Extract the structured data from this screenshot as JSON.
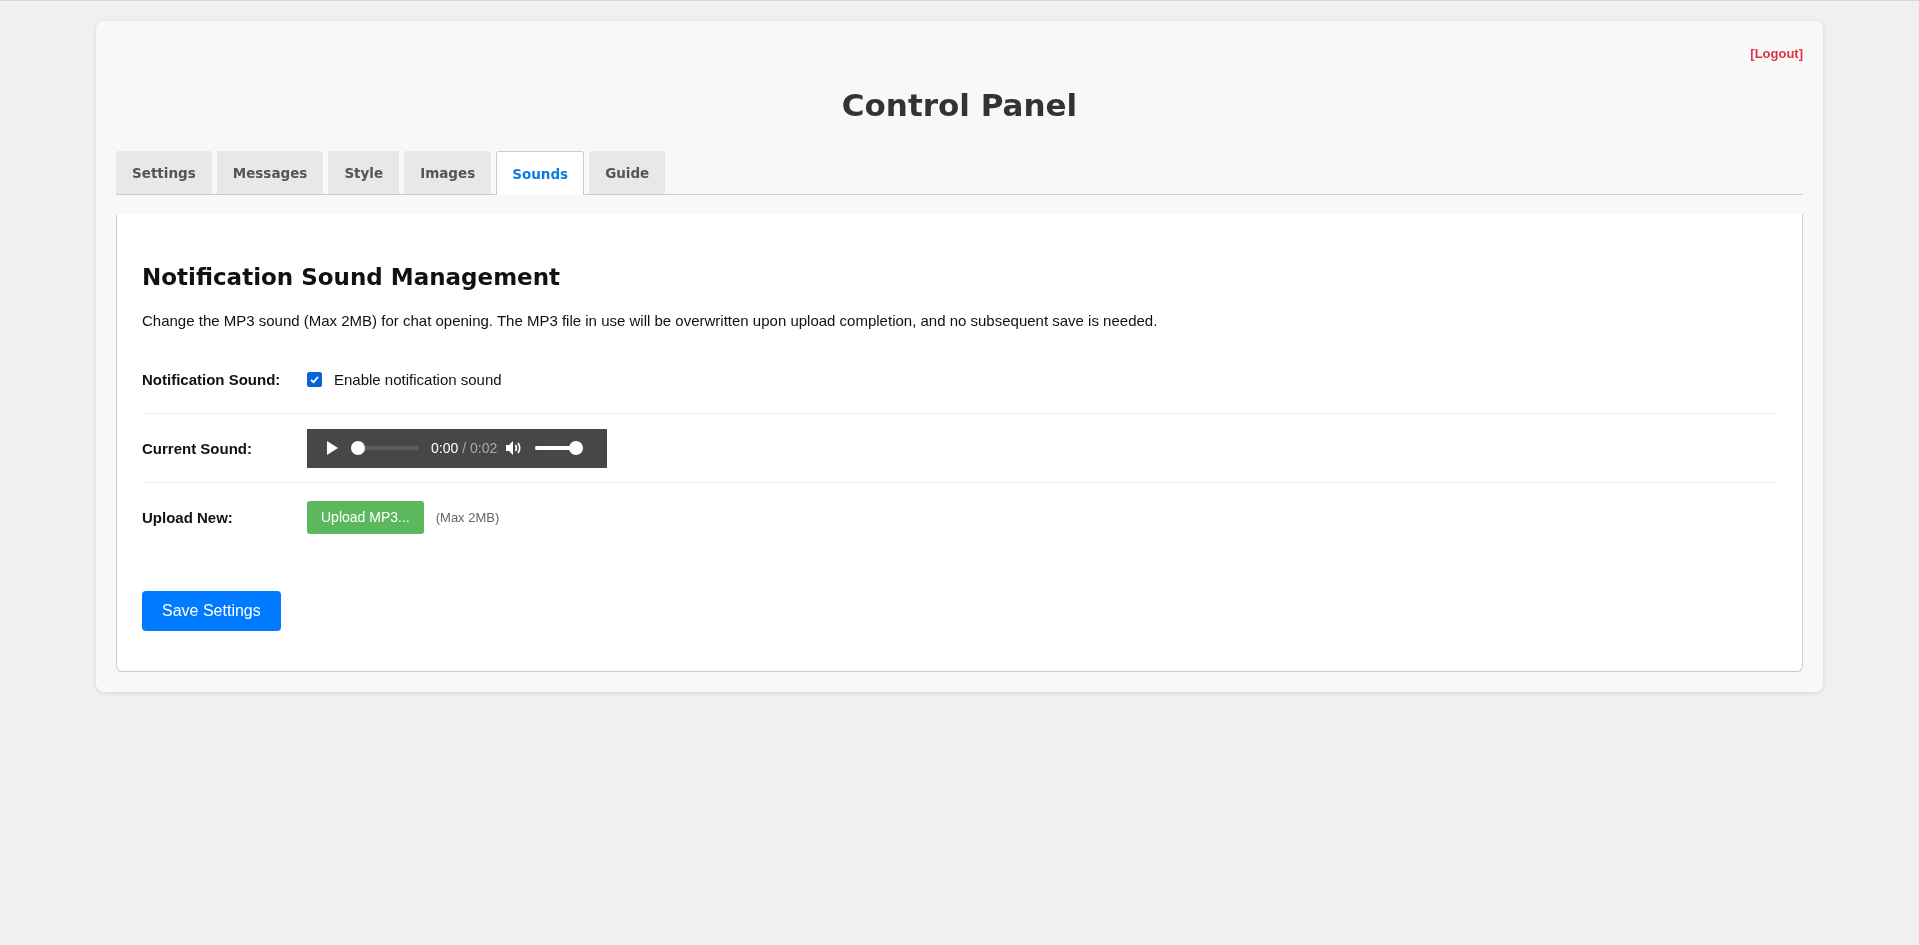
{
  "logout": "[Logout]",
  "title": "Control Panel",
  "tabs": [
    {
      "label": "Settings",
      "selected": false
    },
    {
      "label": "Messages",
      "selected": false
    },
    {
      "label": "Style",
      "selected": false
    },
    {
      "label": "Images",
      "selected": false
    },
    {
      "label": "Sounds",
      "selected": true
    },
    {
      "label": "Guide",
      "selected": false
    }
  ],
  "section": {
    "heading": "Notification Sound Management",
    "description": "Change the MP3 sound (Max 2MB) for chat opening. The MP3 file in use will be overwritten upon upload completion, and no subsequent save is needed.",
    "rows": [
      {
        "kind": "checkbox",
        "label": "Notification Sound:",
        "text": "Enable notification sound",
        "checked": true
      },
      {
        "kind": "audio",
        "label": "Current Sound:",
        "current_time": "0:00",
        "duration": "/ 0:02",
        "level": 0,
        "volume": {
          "level": 1
        }
      },
      {
        "kind": "upload",
        "label": "Upload New:",
        "button": "Upload MP3...",
        "hint": "(Max 2MB)"
      }
    ],
    "save_button": "Save Settings"
  }
}
